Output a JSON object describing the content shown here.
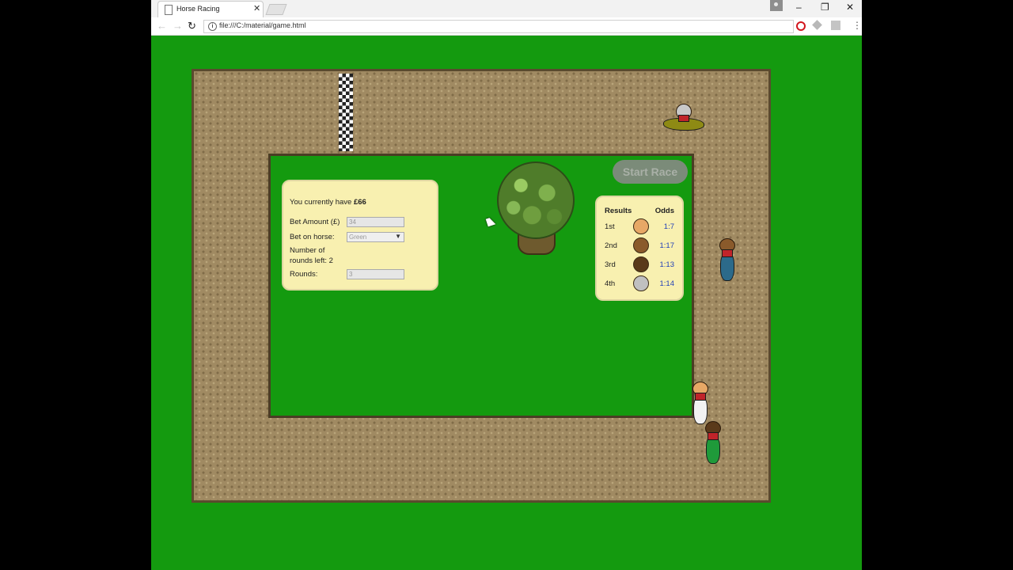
{
  "browser": {
    "tab_title": "Horse Racing",
    "tab_close": "✕",
    "url": "file:///C:/material/game.html",
    "window_controls": [
      "–",
      "❐",
      "✕"
    ]
  },
  "game": {
    "start_button": "Start Race",
    "bet_panel": {
      "money_prefix": "You currently have ",
      "money_value": "£66",
      "bet_amount_label": "Bet Amount (£)",
      "bet_amount_value": "34",
      "bet_horse_label": "Bet on horse:",
      "bet_horse_value": "Green",
      "rounds_left_line1": "Number of",
      "rounds_left_line2": "rounds left: 2",
      "rounds_label": "Rounds:",
      "rounds_value": "3"
    },
    "results": {
      "header_results": "Results",
      "header_odds": "Odds",
      "rows": [
        {
          "place": "1st",
          "odds": "1:7",
          "face_color": "#e7a866"
        },
        {
          "place": "2nd",
          "odds": "1:17",
          "face_color": "#8a5a2b"
        },
        {
          "place": "3rd",
          "odds": "1:13",
          "face_color": "#5a3a1a"
        },
        {
          "place": "4th",
          "odds": "1:14",
          "face_color": "#c0c0c0"
        }
      ]
    }
  },
  "colors": {
    "grass": "#149a0f",
    "track": "#a08a62",
    "panel": "#f8f0b0",
    "odds": "#2341b8"
  }
}
